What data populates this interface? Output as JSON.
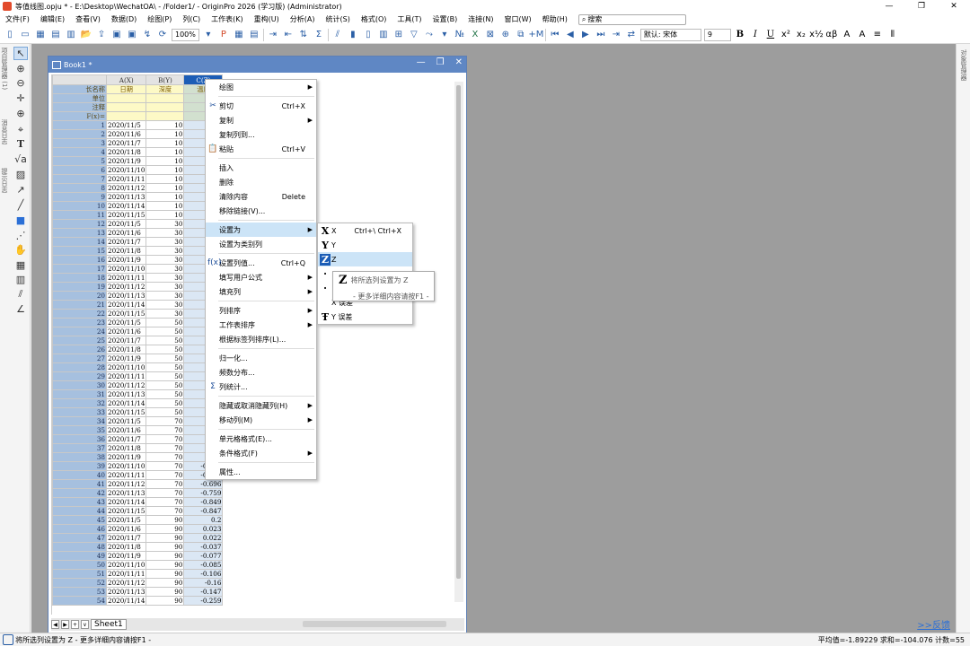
{
  "window": {
    "title": "等值线图.opju * - E:\\Desktop\\WechatOA\\ - /Folder1/ - OriginPro 2026 (学习版) (Administrator)",
    "controls": [
      "—",
      "❐",
      "✕"
    ]
  },
  "menubar": {
    "items": [
      "文件(F)",
      "编辑(E)",
      "查看(V)",
      "数据(D)",
      "绘图(P)",
      "列(C)",
      "工作表(K)",
      "重构(U)",
      "分析(A)",
      "统计(S)",
      "格式(O)",
      "工具(T)",
      "设置(B)",
      "连接(N)",
      "窗口(W)",
      "帮助(H)"
    ],
    "search_placeholder": "搜索"
  },
  "toolbar": {
    "zoom": "100%",
    "font": "默认: 宋体",
    "font_size": "9"
  },
  "left_panel": {
    "labels": [
      "项目管理器 (1)",
      "消息日志",
      "提示日志"
    ]
  },
  "right_panel": {
    "label": "对象管理器"
  },
  "workbook": {
    "title": "Book1 *",
    "sheet_tab": "Sheet1",
    "columns": [
      {
        "name": "A(X)",
        "long_name": "日期"
      },
      {
        "name": "B(Y)",
        "long_name": "深度"
      },
      {
        "name": "C(Z)",
        "long_name": "温度"
      }
    ],
    "meta_rows": [
      "长名称",
      "单位",
      "注释",
      "F(x)="
    ],
    "rows": [
      [
        "2020/11/5",
        "10",
        "-3."
      ],
      [
        "2020/11/6",
        "10",
        "-5."
      ],
      [
        "2020/11/7",
        "10",
        "-6."
      ],
      [
        "2020/11/8",
        "10",
        "-6."
      ],
      [
        "2020/11/9",
        "10",
        "-5."
      ],
      [
        "2020/11/10",
        "10",
        "-5."
      ],
      [
        "2020/11/11",
        "10",
        "-4."
      ],
      [
        "2020/11/12",
        "10",
        "-4."
      ],
      [
        "2020/11/13",
        "10",
        "-4."
      ],
      [
        "2020/11/14",
        "10",
        "-3."
      ],
      [
        "2020/11/15",
        "10",
        "-3."
      ],
      [
        "2020/11/5",
        "30",
        "-1."
      ],
      [
        "2020/11/6",
        "30",
        "-2."
      ],
      [
        "2020/11/7",
        "30",
        "-3."
      ],
      [
        "2020/11/8",
        "30",
        "-3."
      ],
      [
        "2020/11/9",
        "30",
        "-3."
      ],
      [
        "2020/11/10",
        "30",
        "-3."
      ],
      [
        "2020/11/11",
        "30",
        "-3."
      ],
      [
        "2020/11/12",
        "30",
        "-2."
      ],
      [
        "2020/11/13",
        "30",
        "-2."
      ],
      [
        "2020/11/14",
        "30",
        "-2."
      ],
      [
        "2020/11/15",
        "30",
        "-2."
      ],
      [
        "2020/11/5",
        "50",
        "-0."
      ],
      [
        "2020/11/6",
        "50",
        "-"
      ],
      [
        "2020/11/7",
        "50",
        "-0."
      ],
      [
        "2020/11/8",
        "50",
        "-1."
      ],
      [
        "2020/11/9",
        "50",
        "-1."
      ],
      [
        "2020/11/10",
        "50",
        "-1."
      ],
      [
        "2020/11/11",
        "50",
        "-1."
      ],
      [
        "2020/11/12",
        "50",
        "-"
      ],
      [
        "2020/11/13",
        "50",
        "-1."
      ],
      [
        "2020/11/14",
        "50",
        "-1."
      ],
      [
        "2020/11/15",
        "50",
        "-1."
      ],
      [
        "2020/11/5",
        "70",
        "0."
      ],
      [
        "2020/11/6",
        "70",
        "-0."
      ],
      [
        "2020/11/7",
        "70",
        "-0."
      ],
      [
        "2020/11/8",
        "70",
        "-0."
      ],
      [
        "2020/11/9",
        "70",
        "-0."
      ],
      [
        "2020/11/10",
        "70",
        "-0.463"
      ],
      [
        "2020/11/11",
        "70",
        "-0.609"
      ],
      [
        "2020/11/12",
        "70",
        "-0.696"
      ],
      [
        "2020/11/13",
        "70",
        "-0.759"
      ],
      [
        "2020/11/14",
        "70",
        "-0.849"
      ],
      [
        "2020/11/15",
        "70",
        "-0.847"
      ],
      [
        "2020/11/5",
        "90",
        "0.2"
      ],
      [
        "2020/11/6",
        "90",
        "0.023"
      ],
      [
        "2020/11/7",
        "90",
        "0.022"
      ],
      [
        "2020/11/8",
        "90",
        "-0.037"
      ],
      [
        "2020/11/9",
        "90",
        "-0.077"
      ],
      [
        "2020/11/10",
        "90",
        "-0.085"
      ],
      [
        "2020/11/11",
        "90",
        "-0.106"
      ],
      [
        "2020/11/12",
        "90",
        "-0.16"
      ],
      [
        "2020/11/13",
        "90",
        "-0.147"
      ],
      [
        "2020/11/14",
        "90",
        "-0.259"
      ]
    ]
  },
  "context_menu": {
    "items": [
      {
        "label": "绘图",
        "submenu": true
      },
      {
        "sep": true
      },
      {
        "label": "剪切",
        "shortcut": "Ctrl+X",
        "icon": "✂"
      },
      {
        "label": "复制",
        "submenu": true
      },
      {
        "label": "复制列到...",
        "shortcut": ""
      },
      {
        "label": "粘贴",
        "shortcut": "Ctrl+V",
        "icon": "📋"
      },
      {
        "sep": true
      },
      {
        "label": "插入"
      },
      {
        "label": "删除"
      },
      {
        "label": "清除内容",
        "shortcut": "Delete"
      },
      {
        "label": "移除链接(V)..."
      },
      {
        "sep": true
      },
      {
        "label": "设置为",
        "submenu": true,
        "highlight": true
      },
      {
        "label": "设置为类别列"
      },
      {
        "sep": true
      },
      {
        "label": "设置列值...",
        "shortcut": "Ctrl+Q",
        "icon": "f(x)"
      },
      {
        "label": "填写用户公式",
        "submenu": true
      },
      {
        "label": "填充列",
        "submenu": true
      },
      {
        "sep": true
      },
      {
        "label": "列排序",
        "submenu": true
      },
      {
        "label": "工作表排序",
        "submenu": true
      },
      {
        "label": "根据标签列排序(L)..."
      },
      {
        "sep": true
      },
      {
        "label": "归一化..."
      },
      {
        "label": "频数分布..."
      },
      {
        "label": "列统计...",
        "icon": "Σ"
      },
      {
        "sep": true
      },
      {
        "label": "隐藏或取消隐藏列(H)",
        "submenu": true
      },
      {
        "label": "移动列(M)",
        "submenu": true
      },
      {
        "sep": true
      },
      {
        "label": "单元格格式(E)..."
      },
      {
        "label": "条件格式(F)",
        "submenu": true
      },
      {
        "sep": true
      },
      {
        "label": "属性..."
      }
    ]
  },
  "submenu": {
    "items": [
      {
        "icon": "X",
        "label": "X",
        "shortcut": "Ctrl+\\ Ctrl+X"
      },
      {
        "icon": "Y",
        "label": "Y"
      },
      {
        "icon": "Z",
        "label": "Z",
        "highlight": true
      },
      {
        "icon": "·",
        "label": ""
      },
      {
        "icon": "·",
        "label": ""
      },
      {
        "icon": "",
        "label": "X 误差"
      },
      {
        "icon": "Ŧ",
        "label": "Y 误差"
      }
    ]
  },
  "tooltip": {
    "line1": "将所选列设置为 Z",
    "line2": "- 更多详细内容请按F1 -"
  },
  "statusbar": {
    "left": "将所选列设置为 Z - 更多详细内容请按F1 -",
    "right": "平均值=-1.89229 求和=-104.076 计数=55"
  },
  "feedback_link": ">>反馈"
}
